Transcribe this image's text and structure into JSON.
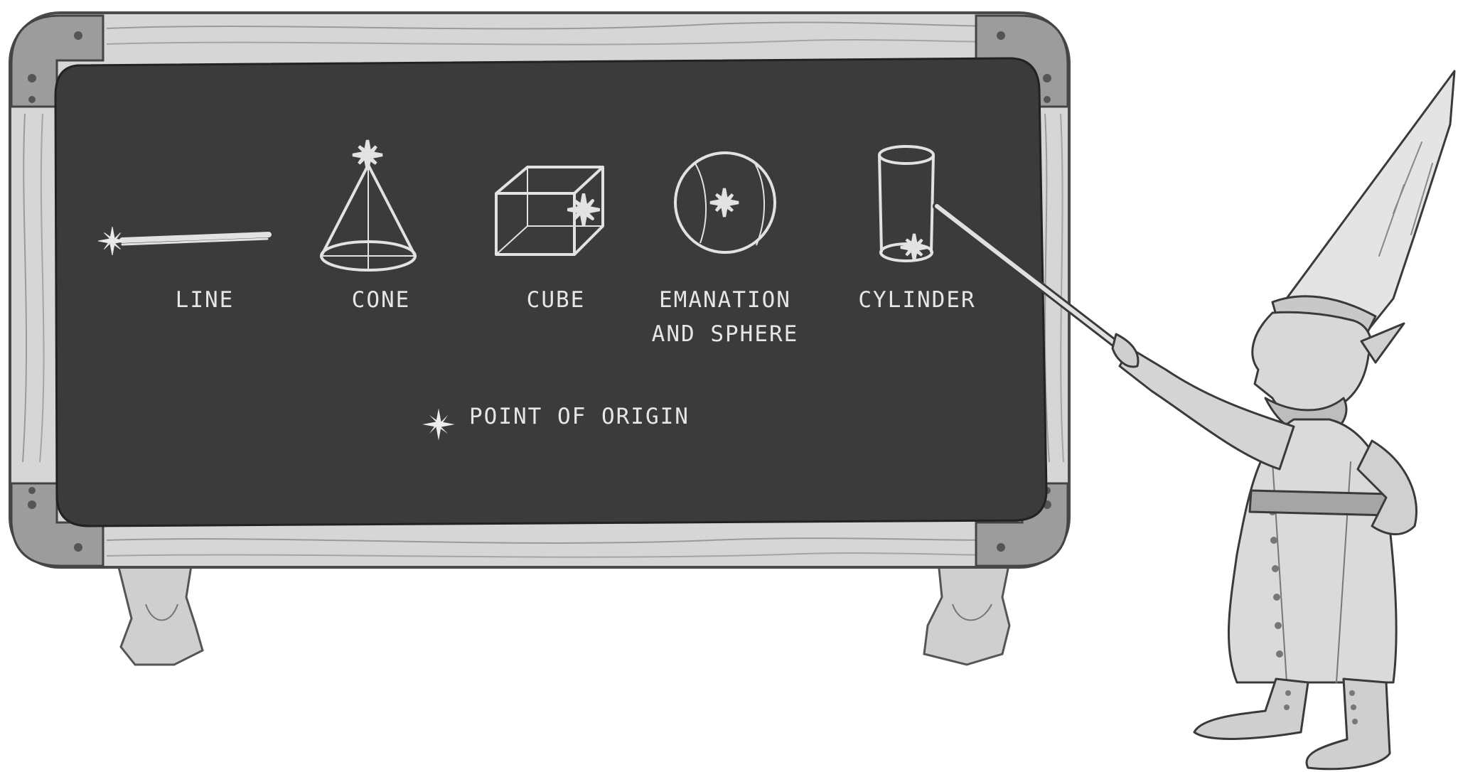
{
  "colors": {
    "chalkboard": "#3b3b3b",
    "chalk": "#e6e6e6",
    "wood": "#d4d4d4",
    "wood_grain": "#9a9a9a",
    "metal": "#8a8a8a"
  },
  "shapes": [
    {
      "id": "line",
      "label": "LINE",
      "icon": "line-shape-icon"
    },
    {
      "id": "cone",
      "label": "CONE",
      "icon": "cone-shape-icon"
    },
    {
      "id": "cube",
      "label": "CUBE",
      "icon": "cube-shape-icon"
    },
    {
      "id": "sphere",
      "label_lines": [
        "EMANATION",
        "AND SPHERE"
      ],
      "icon": "sphere-shape-icon"
    },
    {
      "id": "cylinder",
      "label": "CYLINDER",
      "icon": "cylinder-shape-icon"
    }
  ],
  "legend": {
    "label": "POINT OF ORIGIN",
    "icon": "point-of-origin-star-icon"
  },
  "illustration": {
    "icon": "gnome-with-pointer-icon"
  }
}
